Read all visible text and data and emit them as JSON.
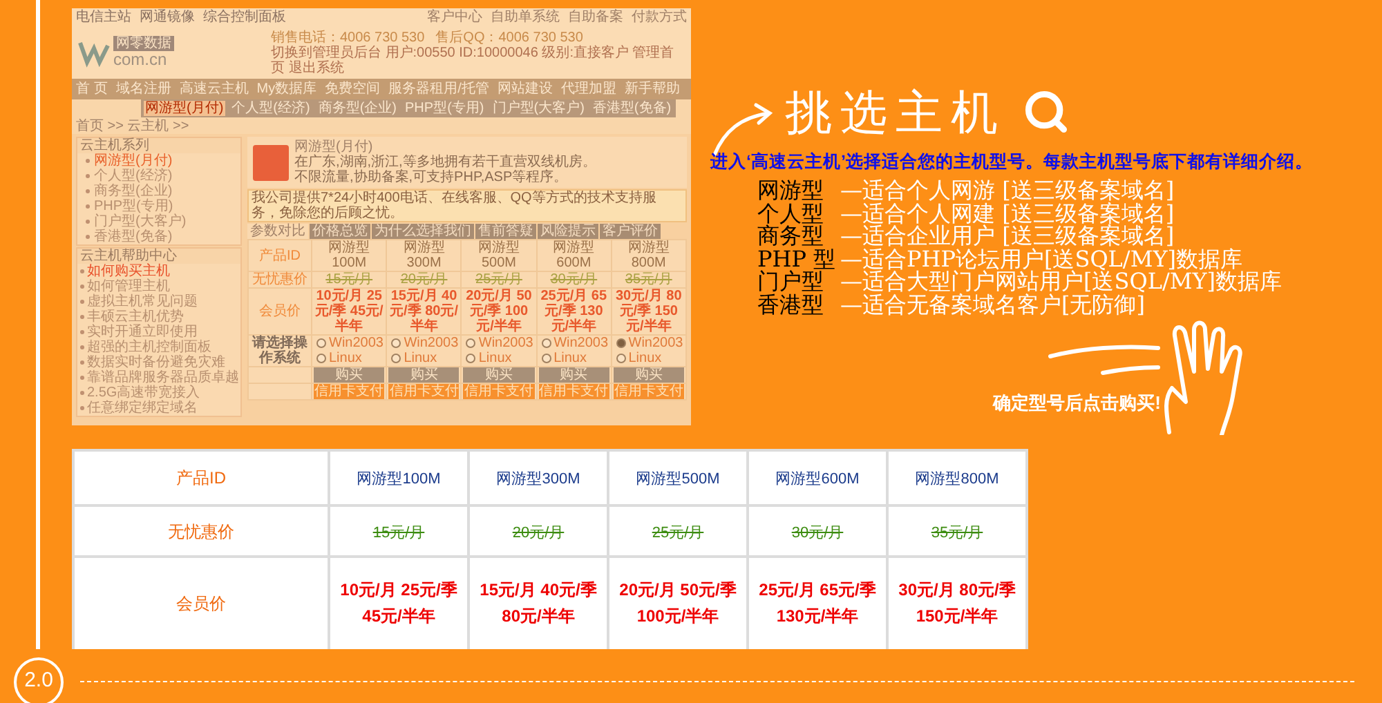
{
  "embedded_site": {
    "top_links_left": [
      "电信主站",
      "网通镜像",
      "综合控制面板"
    ],
    "top_links_right": [
      "客户中心",
      "自助单系统",
      "自助备案",
      "付款方式"
    ],
    "logo": {
      "name": "网零数据",
      "domain": "com.cn"
    },
    "sales_phone": "销售电话：4006 730 530",
    "support_qq": "售后QQ：4006 730 530",
    "user_info": "切换到管理员后台 用户:00550 ID:10000046 级别:直接客户 管理首页 退出系统",
    "nav": [
      "首 页",
      "域名注册",
      "高速云主机",
      "My数据库",
      "免费空间",
      "服务器租用/托管",
      "网站建设",
      "代理加盟",
      "新手帮助"
    ],
    "breadcrumb": "首页 >> 云主机 >>",
    "subnav": [
      {
        "label": "网游型(月付)",
        "selected": true
      },
      {
        "label": "个人型(经济)",
        "selected": false
      },
      {
        "label": "商务型(企业)",
        "selected": false
      },
      {
        "label": "PHP型(专用)",
        "selected": false
      },
      {
        "label": "门户型(大客户)",
        "selected": false
      },
      {
        "label": "香港型(免备)",
        "selected": false
      }
    ],
    "series": {
      "title": "云主机系列",
      "items": [
        {
          "label": "网游型(月付)",
          "selected": true
        },
        {
          "label": "个人型(经济)",
          "selected": false
        },
        {
          "label": "商务型(企业)",
          "selected": false
        },
        {
          "label": "PHP型(专用)",
          "selected": false
        },
        {
          "label": "门户型(大客户)",
          "selected": false
        },
        {
          "label": "香港型(免备)",
          "selected": false
        }
      ]
    },
    "help": {
      "title": "云主机帮助中心",
      "items": [
        {
          "label": "如何购买主机",
          "selected": true
        },
        {
          "label": "如何管理主机",
          "selected": false
        },
        {
          "label": "虚拟主机常见问题",
          "selected": false
        },
        {
          "label": "丰硕云主机优势",
          "selected": false
        },
        {
          "label": "实时开通立即使用",
          "selected": false
        },
        {
          "label": "超强的主机控制面板",
          "selected": false
        },
        {
          "label": "数据实时备份避免灾难",
          "selected": false
        },
        {
          "label": "靠谱品牌服务器品质卓越",
          "selected": false
        },
        {
          "label": "2.5G高速带宽接入",
          "selected": false
        },
        {
          "label": "任意绑定绑定域名",
          "selected": false
        }
      ]
    },
    "product": {
      "title": "网游型(月付)",
      "description": [
        "在广东,湖南,浙江,等多地拥有若干直营双线机房。",
        "不限流量,协助备案,可支持PHP,ASP等程序。"
      ]
    },
    "notice": "我公司提供7*24小时400电话、在线客服、QQ等方式的技术支持服务，免除您的后顾之忧。",
    "tabs": [
      {
        "label": "参数对比",
        "selected": true
      },
      {
        "label": "价格总览",
        "selected": false
      },
      {
        "label": "为什么选择我们",
        "selected": false
      },
      {
        "label": "售前答疑",
        "selected": false
      },
      {
        "label": "风险提示",
        "selected": false
      },
      {
        "label": "客户评价",
        "selected": false
      }
    ],
    "table": [
      {
        "kind": "product",
        "label": "产品ID",
        "cells": [
          "网游型100M",
          "网游型300M",
          "网游型500M",
          "网游型600M",
          "网游型800M"
        ]
      },
      {
        "kind": "strike",
        "label": "无忧惠价",
        "cells": [
          "15元/月",
          "20元/月",
          "25元/月",
          "30元/月",
          "35元/月"
        ]
      },
      {
        "kind": "price",
        "label": "会员价",
        "cells": [
          "10元/月 25元/季 45元/半年",
          "15元/月 40元/季 80元/半年",
          "20元/月 50元/季 100元/半年",
          "25元/月 65元/季 130元/半年",
          "30元/月 80元/季 150元/半年"
        ]
      },
      {
        "kind": "os",
        "label": "请选择操作系统",
        "cells": [
          [
            {
              "label": "Win2003",
              "checked": false
            },
            {
              "label": "Linux",
              "checked": false
            }
          ],
          [
            {
              "label": "Win2003",
              "checked": false
            },
            {
              "label": "Linux",
              "checked": false
            }
          ],
          [
            {
              "label": "Win2003",
              "checked": false
            },
            {
              "label": "Linux",
              "checked": false
            }
          ],
          [
            {
              "label": "Win2003",
              "checked": false
            },
            {
              "label": "Linux",
              "checked": false
            }
          ],
          [
            {
              "label": "Win2003",
              "checked": true
            },
            {
              "label": "Linux",
              "checked": false
            }
          ]
        ]
      },
      {
        "kind": "buy",
        "cells": [
          "购买",
          "购买",
          "购买",
          "购买",
          "购买"
        ]
      },
      {
        "kind": "pay",
        "cells": [
          "信用卡支付",
          "信用卡支付",
          "信用卡支付",
          "信用卡支付",
          "信用卡支付"
        ]
      }
    ]
  },
  "promo": {
    "title": "挑选主机",
    "intro": "进入‘高速云主机’选择适合您的主机型号。每款主机型号底下都有详细介绍。",
    "types": [
      {
        "name": "网游型",
        "desc": "—适合个人网游 [送三级备案域名]"
      },
      {
        "name": "个人型",
        "desc": "—适合个人网建 [送三级备案域名]"
      },
      {
        "name": "商务型",
        "desc": "—适合企业用户 [送三级备案域名]"
      },
      {
        "name": "PHP 型",
        "desc": "—适合PHP论坛用户[送SQL/MY]数据库"
      },
      {
        "name": "门户型",
        "desc": "—适合大型门户网站用户[送SQL/MY]数据库"
      },
      {
        "name": "香港型",
        "desc": "—适合无备案域名客户[无防御]"
      }
    ],
    "cta": "确定型号后点击购买!"
  },
  "pricing_table": [
    {
      "kind": "product",
      "label": "产品ID",
      "cells": [
        "网游型100M",
        "网游型300M",
        "网游型500M",
        "网游型600M",
        "网游型800M"
      ]
    },
    {
      "kind": "strike",
      "label": "无忧惠价",
      "cells": [
        "15元/月",
        "20元/月",
        "25元/月",
        "30元/月",
        "35元/月"
      ]
    },
    {
      "kind": "price",
      "label": "会员价",
      "cells": [
        "10元/月 25元/季 45元/半年",
        "15元/月 40元/季 80元/半年",
        "20元/月 50元/季 100元/半年",
        "25元/月 65元/季 130元/半年",
        "30元/月 80元/季 150元/半年"
      ]
    }
  ],
  "page_number": "2.0"
}
